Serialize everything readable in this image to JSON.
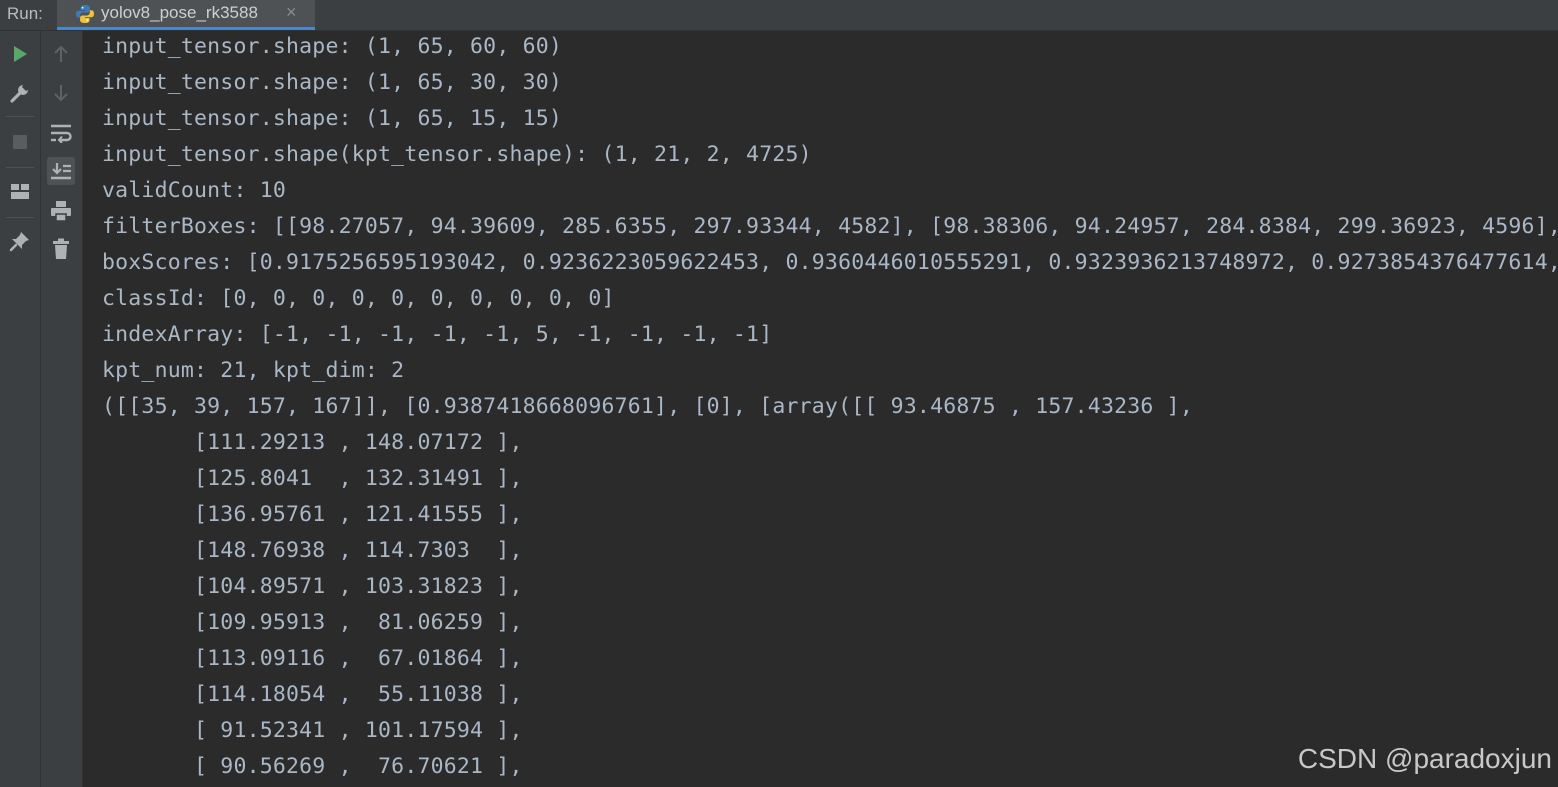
{
  "header": {
    "run_label": "Run:",
    "tab_title": "yolov8_pose_rk3588",
    "tab_close": "×"
  },
  "toolbar_left": {
    "items": [
      "run-icon",
      "wrench-icon",
      "stop-icon",
      "layout-icon",
      "pin-icon"
    ]
  },
  "toolbar_right": {
    "items": [
      "up-arrow-icon",
      "down-arrow-icon",
      "soft-wrap-icon",
      "scroll-to-end-icon",
      "print-icon",
      "trash-icon"
    ]
  },
  "console": {
    "lines": [
      "input_tensor.shape: (1, 65, 60, 60)",
      "input_tensor.shape: (1, 65, 30, 30)",
      "input_tensor.shape: (1, 65, 15, 15)",
      "input_tensor.shape(kpt_tensor.shape): (1, 21, 2, 4725)",
      "validCount: 10",
      "filterBoxes: [[98.27057, 94.39609, 285.6355, 297.93344, 4582], [98.38306, 94.24957, 284.8384, 299.36923, 4596],",
      "boxScores: [0.9175256595193042, 0.9236223059622453, 0.9360446010555291, 0.9323936213748972, 0.9273854376477614,",
      "classId: [0, 0, 0, 0, 0, 0, 0, 0, 0, 0]",
      "indexArray: [-1, -1, -1, -1, -1, 5, -1, -1, -1, -1]",
      "kpt_num: 21, kpt_dim: 2",
      "([[35, 39, 157, 167]], [0.9387418668096761], [0], [array([[ 93.46875 , 157.43236 ],",
      "       [111.29213 , 148.07172 ],",
      "       [125.8041  , 132.31491 ],",
      "       [136.95761 , 121.41555 ],",
      "       [148.76938 , 114.7303  ],",
      "       [104.89571 , 103.31823 ],",
      "       [109.95913 ,  81.06259 ],",
      "       [113.09116 ,  67.01864 ],",
      "       [114.18054 ,  55.11038 ],",
      "       [ 91.52341 , 101.17594 ],",
      "       [ 90.56269 ,  76.70621 ],"
    ]
  },
  "watermark": "CSDN @paradoxjun",
  "colors": {
    "background": "#2b2b2b",
    "toolbar": "#3c3f41",
    "text": "#a9b7c6",
    "run_green": "#59a869",
    "tab_accent": "#4a88c7"
  }
}
